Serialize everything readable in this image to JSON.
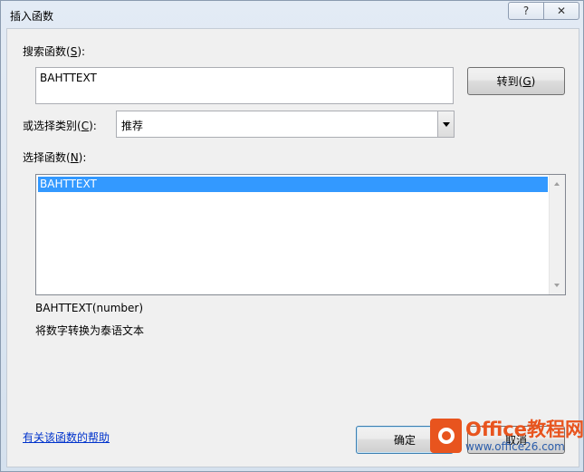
{
  "window": {
    "title": "插入函数",
    "help_button_glyph": "?",
    "close_button_glyph": "✕"
  },
  "search": {
    "label": "搜索函数(",
    "label_key": "S",
    "label_end": "):",
    "value": "BAHTTEXT",
    "goto_label": "转到(",
    "goto_key": "G",
    "goto_end": ")"
  },
  "category": {
    "label": "或选择类别(",
    "label_key": "C",
    "label_end": "):",
    "selected": "推荐"
  },
  "functions": {
    "label": "选择函数(",
    "label_key": "N",
    "label_end": "):",
    "items": [
      "BAHTTEXT"
    ],
    "selected_index": 0
  },
  "description": {
    "signature": "BAHTTEXT(number)",
    "text": "将数字转换为泰语文本"
  },
  "footer": {
    "help_link": "有关该函数的帮助",
    "ok_label": "确定",
    "cancel_label": "取消"
  },
  "watermark": {
    "main": "Office教程网",
    "sub": "www.office26.com"
  },
  "colors": {
    "selection": "#3399ff",
    "link": "#0033cc",
    "watermark_orange": "#e8541e"
  }
}
